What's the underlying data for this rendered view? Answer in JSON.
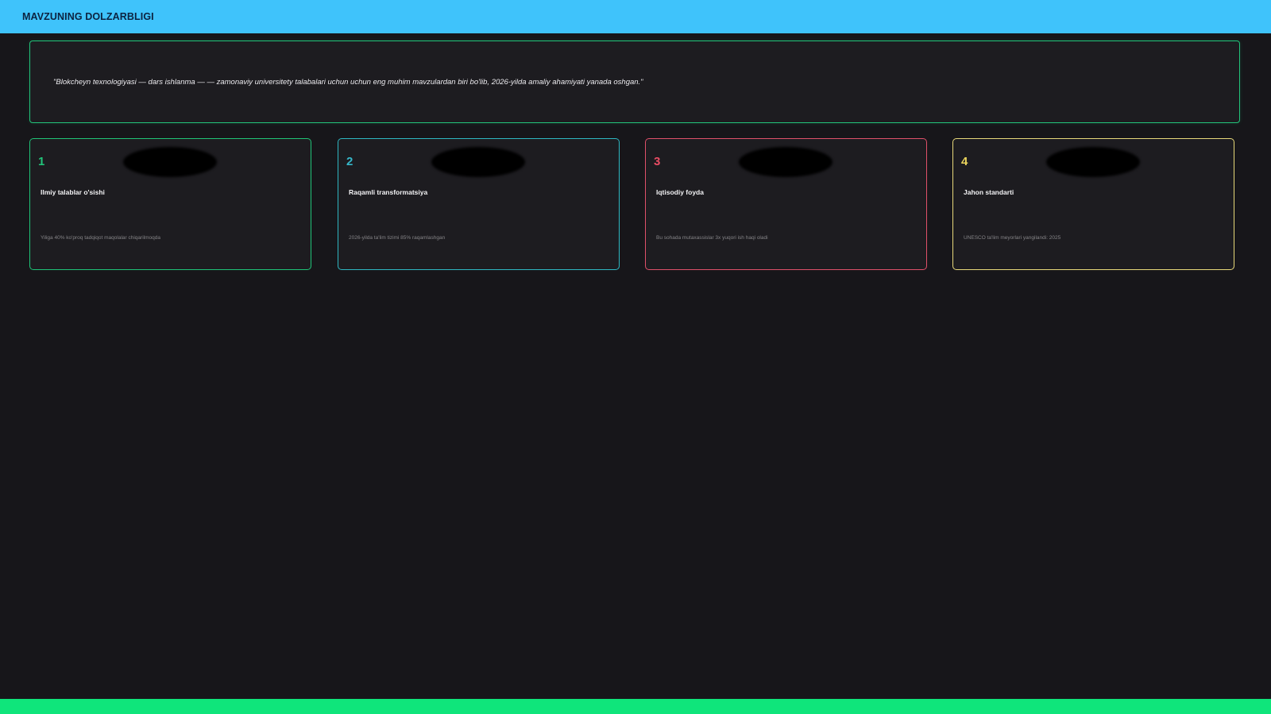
{
  "header": {
    "title": "MAVZUNING DOLZARBLIGI"
  },
  "quote": {
    "text": "\"Blokcheyn texnologiyasi — dars ishlanma — — zamonaviy universitety talabalari uchun uchun eng muhim mavzulardan biri bo'lib, 2026-yilda amaliy ahamiyati yanada oshgan.\""
  },
  "cards": [
    {
      "number": "1",
      "title": "Ilmiy talablar o'sishi",
      "description": "Yiliga 40% ko'proq tadqiqot maqolalar chiqarilmoqda",
      "accent": "#1fc477",
      "number_color": "#22c47a"
    },
    {
      "number": "2",
      "title": "Raqamli transformatsiya",
      "description": "2026-yilda ta'lim tizimi 85% raqamlashgan",
      "accent": "#2eb7c2",
      "number_color": "#36b7c9"
    },
    {
      "number": "3",
      "title": "Iqtisodiy foyda",
      "description": "Bu sohada mutaxassislar 3x yuqori ish haqi oladi",
      "accent": "#e0506a",
      "number_color": "#ea4d64"
    },
    {
      "number": "4",
      "title": "Jahon standarti",
      "description": "UNESCO ta'lim meyorlari yangilandi: 2025",
      "accent": "#e8d97a",
      "number_color": "#ecd55c"
    }
  ],
  "colors": {
    "header_bg": "#3fc3fb",
    "background": "#17161a",
    "footer_bar": "#0fe57b",
    "quote_border": "#22c47a"
  }
}
